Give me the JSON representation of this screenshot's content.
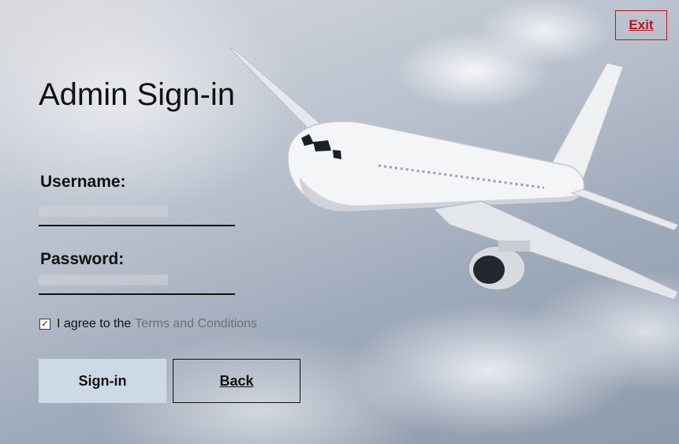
{
  "window": {
    "exit_label": "Exit"
  },
  "form": {
    "title": "Admin Sign-in",
    "username_label": "Username:",
    "username_value": "",
    "password_label": "Password:",
    "password_value": "",
    "agree_text": "I agree to the",
    "terms_link": "Terms and Conditions",
    "agree_checked": true
  },
  "buttons": {
    "signin_label": "Sign-in",
    "back_label": "Back"
  },
  "background": {
    "image": "airplane-in-clouds"
  },
  "colors": {
    "exit_red": "#c0141a",
    "signin_bg": "#cdd9e5",
    "link_gray": "#6b6f77"
  }
}
